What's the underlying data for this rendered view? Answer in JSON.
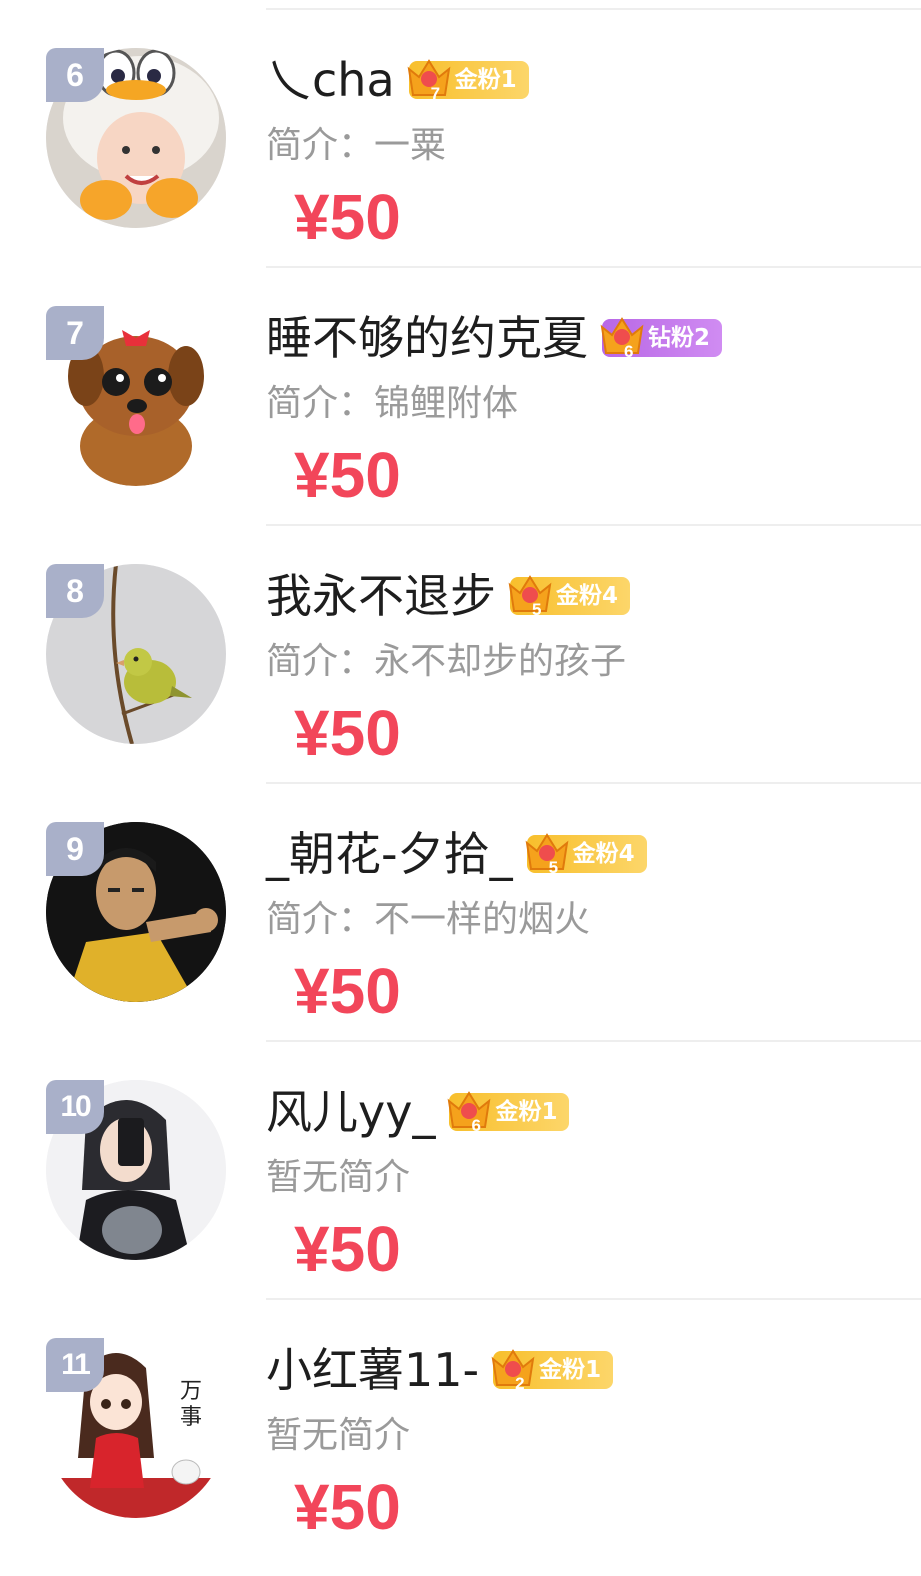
{
  "colors": {
    "price": "#f2465a",
    "rank_badge": "#a9b0c9",
    "gold_badge": "#f8bf2c",
    "diamond_badge": "#b867e6",
    "intro_text": "#9a9a9a"
  },
  "items": [
    {
      "rank": "6",
      "name": "乀cha",
      "badge": {
        "crown_level": "7",
        "label": "金粉1",
        "tier": "gold"
      },
      "intro": "简介：一粟",
      "price": "¥50",
      "avatar_icon": "child-duck-hat-avatar"
    },
    {
      "rank": "7",
      "name": "睡不够的约克夏",
      "badge": {
        "crown_level": "6",
        "label": "钻粉2",
        "tier": "diamond"
      },
      "intro": "简介：锦鲤附体",
      "price": "¥50",
      "avatar_icon": "yorkie-dog-avatar"
    },
    {
      "rank": "8",
      "name": "我永不退步",
      "badge": {
        "crown_level": "5",
        "label": "金粉4",
        "tier": "gold"
      },
      "intro": "简介：永不却步的孩子",
      "price": "¥50",
      "avatar_icon": "bird-on-branch-avatar"
    },
    {
      "rank": "9",
      "name": "_朝花-夕拾_",
      "badge": {
        "crown_level": "5",
        "label": "金粉4",
        "tier": "gold"
      },
      "intro": "简介：不一样的烟火",
      "price": "¥50",
      "avatar_icon": "martial-artist-avatar"
    },
    {
      "rank": "10",
      "name": "风儿yy_",
      "badge": {
        "crown_level": "6",
        "label": "金粉1",
        "tier": "gold"
      },
      "intro": "暂无简介",
      "price": "¥50",
      "avatar_icon": "girl-selfie-avatar"
    },
    {
      "rank": "11",
      "name": "小红薯11-",
      "badge": {
        "crown_level": "2",
        "label": "金粉1",
        "tier": "gold"
      },
      "intro": "暂无简介",
      "price": "¥50",
      "avatar_icon": "cartoon-girl-avatar"
    }
  ]
}
